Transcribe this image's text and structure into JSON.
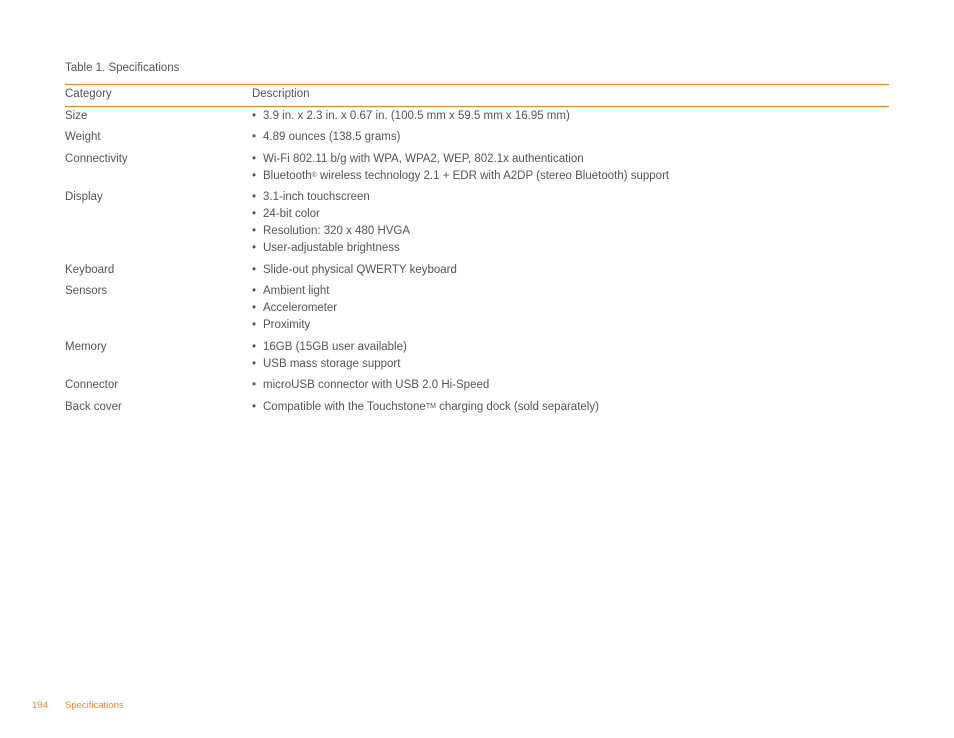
{
  "table": {
    "caption": "Table 1.  Specifications",
    "headers": {
      "category": "Category",
      "description": "Description"
    },
    "rows": [
      {
        "category": "Size",
        "items": [
          "3.9 in. x 2.3 in. x 0.67 in. (100.5 mm x 59.5 mm x 16.95 mm)"
        ]
      },
      {
        "category": "Weight",
        "items": [
          "4.89 ounces (138.5 grams)"
        ]
      },
      {
        "category": "Connectivity",
        "items": [
          "Wi-Fi 802.11 b/g with WPA, WPA2, WEP, 802.1x authentication",
          "Bluetooth® wireless technology 2.1 + EDR with A2DP (stereo Bluetooth) support"
        ]
      },
      {
        "category": "Display",
        "items": [
          "3.1-inch touchscreen",
          "24-bit color",
          "Resolution: 320 x 480 HVGA",
          "User-adjustable brightness"
        ]
      },
      {
        "category": "Keyboard",
        "items": [
          "Slide-out physical QWERTY keyboard"
        ]
      },
      {
        "category": "Sensors",
        "items": [
          "Ambient light",
          "Accelerometer",
          "Proximity"
        ]
      },
      {
        "category": "Memory",
        "items": [
          "16GB (15GB user available)",
          "USB mass storage support"
        ]
      },
      {
        "category": "Connector",
        "items": [
          "microUSB connector with USB 2.0 Hi-Speed"
        ]
      },
      {
        "category": "Back cover",
        "items": [
          "Compatible with the Touchstone™ charging dock (sold separately)"
        ]
      }
    ]
  },
  "bullet_glyph": "•",
  "footer": {
    "page_number": "194",
    "section": "Specifications"
  },
  "colors": {
    "accent": "#f08a24",
    "text": "#555555"
  }
}
